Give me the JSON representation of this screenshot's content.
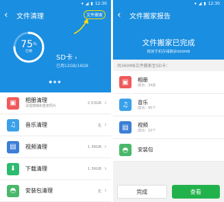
{
  "left_screen": {
    "status": {
      "time": "12:30"
    },
    "title": "文件清理",
    "mover_button": "文件搬家",
    "gauge": {
      "percent": "75",
      "percent_sign": "%",
      "label": "已用",
      "fraction": 0.75
    },
    "storage": {
      "name": "SD卡",
      "usage": "已用12GB/16GB"
    },
    "pager": {
      "pages": 3,
      "active": 0
    },
    "items": [
      {
        "label": "相册清理",
        "sub": "清理模糊和重复照片",
        "value": "2.53GB",
        "icon": "photo-icon",
        "color": "#f05a5a",
        "glyph": "▣"
      },
      {
        "label": "音乐清理",
        "sub": "",
        "value": "无",
        "icon": "music-icon",
        "color": "#3aa0ea",
        "glyph": "♫"
      },
      {
        "label": "视频清理",
        "sub": "",
        "value": "1.36GB",
        "icon": "video-icon",
        "color": "#3b7fd6",
        "glyph": "▤"
      },
      {
        "label": "下载清理",
        "sub": "",
        "value": "1.36GB",
        "icon": "download-icon",
        "color": "#2dbb6f",
        "glyph": "⬇"
      },
      {
        "label": "安装包清理",
        "sub": "",
        "value": "无",
        "icon": "android-icon",
        "color": "#49b86a",
        "glyph": "◓"
      }
    ]
  },
  "right_screen": {
    "status": {
      "time": "12:30"
    },
    "title": "文件搬家报告",
    "banner": {
      "title": "文件搬家已完成",
      "subtitle": "释放手机存储剩余666MB"
    },
    "section_label": "共360MB文件搬家至SD卡：",
    "items": [
      {
        "label": "相册",
        "sub": "成功：34张",
        "icon": "photo-icon",
        "color": "#f05a5a",
        "glyph": "▣"
      },
      {
        "label": "音乐",
        "sub": "成功：45个",
        "icon": "music-icon",
        "color": "#3aa0ea",
        "glyph": "♫"
      },
      {
        "label": "视频",
        "sub": "成功：22个",
        "icon": "video-icon",
        "color": "#3b7fd6",
        "glyph": "▤"
      },
      {
        "label": "安装包",
        "sub": "",
        "icon": "android-icon",
        "color": "#49b86a",
        "glyph": "◓"
      }
    ],
    "buttons": {
      "done": "完成",
      "view": "查看"
    }
  },
  "colors": {
    "primary": "#1a8ee0",
    "accent_green": "#22b24c",
    "highlight": "#ffe000"
  }
}
